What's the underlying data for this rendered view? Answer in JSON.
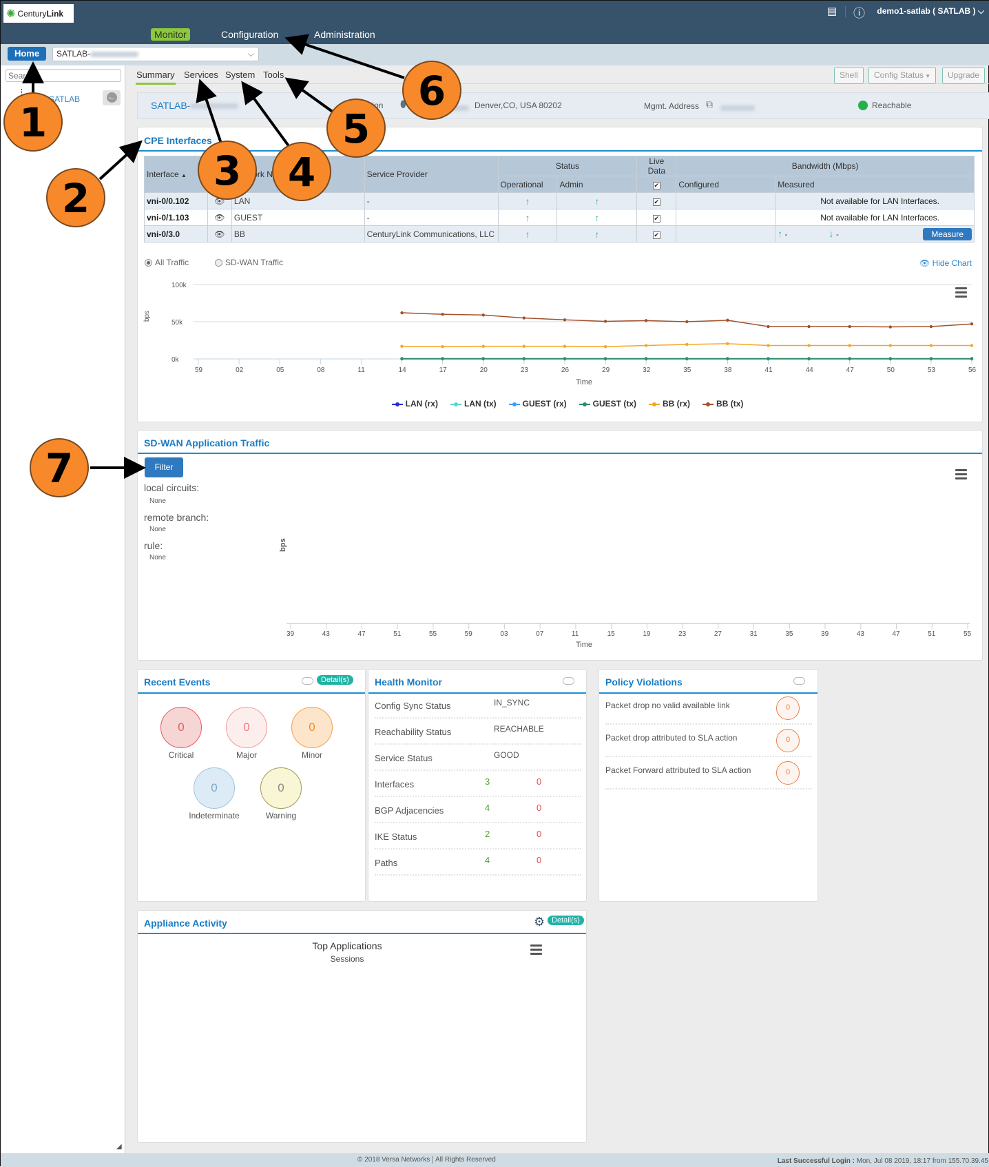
{
  "header": {
    "logo_text_light": "Century",
    "logo_text_bold": "Link",
    "nav": [
      {
        "label": "Monitor",
        "active": true
      },
      {
        "label": "Configuration"
      },
      {
        "label": "Administration"
      }
    ],
    "user": "demo1-satlab ( SATLAB )"
  },
  "subbar": {
    "home": "Home",
    "appliance_select": "SATLAB-"
  },
  "sidebar": {
    "search_placeholder": "Search",
    "tree_item": "SATLAB"
  },
  "tabs": [
    "Summary",
    "Services",
    "System",
    "Tools"
  ],
  "actions": {
    "shell": "Shell",
    "config_status": "Config Status",
    "upgrade": "Upgrade"
  },
  "info": {
    "name": "SATLAB-",
    "location_label": "Location",
    "address": "Denver,CO, USA 80202",
    "mgmt_label": "Mgmt. Address",
    "status": "Reachable",
    "status_color": "#22b24c"
  },
  "cpe": {
    "title": "CPE Interfaces",
    "headers": {
      "interface": "Interface",
      "network": "Network Name",
      "provider": "Service Provider",
      "status": "Status",
      "operational": "Operational",
      "admin": "Admin",
      "live": "Live Data",
      "bandwidth": "Bandwidth (Mbps)",
      "configured": "Configured",
      "measured": "Measured"
    },
    "rows": [
      {
        "interface": "vni-0/0.102",
        "network": "LAN",
        "provider": "-",
        "operational": "up",
        "admin": "up",
        "live": true,
        "measured": "Not available for LAN Interfaces."
      },
      {
        "interface": "vni-0/1.103",
        "network": "GUEST",
        "provider": "-",
        "operational": "up",
        "admin": "up",
        "live": true,
        "measured": "Not available for LAN Interfaces."
      },
      {
        "interface": "vni-0/3.0",
        "network": "BB",
        "provider": "CenturyLink Communications, LLC",
        "operational": "up",
        "admin": "up",
        "live": true,
        "measured_up": "-",
        "measured_down": "-",
        "measure_button": "Measure"
      }
    ],
    "radio_all": "All Traffic",
    "radio_sdwan": "SD-WAN Traffic",
    "selected_radio": "All Traffic",
    "hide_chart": "Hide Chart"
  },
  "chart_data": [
    {
      "type": "line",
      "xlabel": "Time",
      "ylabel": "bps",
      "yticks": [
        "0k",
        "50k",
        "100k"
      ],
      "ylim": [
        0,
        100000
      ],
      "categories": [
        "59",
        "02",
        "05",
        "08",
        "11",
        "14",
        "17",
        "20",
        "23",
        "26",
        "29",
        "32",
        "35",
        "38",
        "41",
        "44",
        "47",
        "50",
        "53",
        "56"
      ],
      "legend_placement": "bottom",
      "grid": true,
      "series": [
        {
          "name": "LAN (rx)",
          "color": "#2230d6",
          "values": [
            null,
            null,
            null,
            null,
            null,
            0,
            0,
            0,
            0,
            0,
            0,
            0,
            0,
            0,
            0,
            0,
            0,
            0,
            0,
            0
          ]
        },
        {
          "name": "LAN (tx)",
          "color": "#55d8c8",
          "values": [
            null,
            null,
            null,
            null,
            null,
            0,
            0,
            0,
            0,
            0,
            0,
            0,
            0,
            0,
            0,
            0,
            0,
            0,
            0,
            0
          ]
        },
        {
          "name": "GUEST (rx)",
          "color": "#3f9ef5",
          "values": [
            null,
            null,
            null,
            null,
            null,
            0,
            0,
            0,
            0,
            0,
            0,
            0,
            0,
            0,
            0,
            0,
            0,
            0,
            0,
            0
          ]
        },
        {
          "name": "GUEST (tx)",
          "color": "#2e8b6b",
          "values": [
            null,
            null,
            null,
            null,
            null,
            500,
            500,
            500,
            500,
            500,
            500,
            500,
            500,
            500,
            500,
            500,
            500,
            500,
            500,
            500
          ]
        },
        {
          "name": "BB (rx)",
          "color": "#f5a623",
          "values": [
            null,
            null,
            null,
            null,
            null,
            17000,
            16500,
            17000,
            17000,
            17000,
            16500,
            18000,
            19500,
            20500,
            18000,
            18000,
            18000,
            18000,
            18000,
            18000
          ]
        },
        {
          "name": "BB (tx)",
          "color": "#a0522d",
          "values": [
            null,
            null,
            null,
            null,
            null,
            62000,
            60000,
            59000,
            55000,
            52500,
            50500,
            51500,
            50000,
            52000,
            43500,
            43500,
            43500,
            43000,
            43500,
            47000
          ]
        }
      ]
    },
    {
      "type": "line",
      "xlabel": "Time",
      "ylabel": "bps",
      "categories": [
        "39",
        "43",
        "47",
        "51",
        "55",
        "59",
        "03",
        "07",
        "11",
        "15",
        "19",
        "23",
        "27",
        "31",
        "35",
        "39",
        "43",
        "47",
        "51",
        "55"
      ],
      "series": []
    }
  ],
  "sdwan": {
    "title": "SD-WAN Application Traffic",
    "filter": "Filter",
    "filters": [
      {
        "label": "local circuits:",
        "value": "None"
      },
      {
        "label": "remote branch:",
        "value": "None"
      },
      {
        "label": "rule:",
        "value": "None"
      }
    ]
  },
  "events": {
    "title": "Recent Events",
    "detail": "Detail(s)",
    "items": [
      {
        "label": "Critical",
        "count": "0"
      },
      {
        "label": "Major",
        "count": "0"
      },
      {
        "label": "Minor",
        "count": "0"
      },
      {
        "label": "Indeterminate",
        "count": "0"
      },
      {
        "label": "Warning",
        "count": "0"
      }
    ]
  },
  "health": {
    "title": "Health Monitor",
    "rows": [
      {
        "label": "Config Sync Status",
        "value": "IN_SYNC"
      },
      {
        "label": "Reachability Status",
        "value": "REACHABLE"
      },
      {
        "label": "Service Status",
        "value": "GOOD"
      },
      {
        "label": "Interfaces",
        "good": "3",
        "bad": "0"
      },
      {
        "label": "BGP Adjacencies",
        "good": "4",
        "bad": "0"
      },
      {
        "label": "IKE Status",
        "good": "2",
        "bad": "0"
      },
      {
        "label": "Paths",
        "good": "4",
        "bad": "0"
      }
    ]
  },
  "policy": {
    "title": "Policy Violations",
    "rows": [
      {
        "label": "Packet drop no valid available link",
        "count": "0"
      },
      {
        "label": "Packet drop attributed to SLA action",
        "count": "0"
      },
      {
        "label": "Packet Forward attributed to SLA action",
        "count": "0"
      }
    ]
  },
  "appliance": {
    "title": "Appliance Activity",
    "detail": "Detail(s)",
    "chart_title": "Top Applications",
    "chart_subtitle": "Sessions"
  },
  "footer": {
    "copyright": "© 2018 Versa Networks",
    "rights": "All Rights Reserved",
    "login_label": "Last Successful Login :",
    "login_value": " Mon, Jul 08 2019, 18:17 from 155.70.39.45"
  },
  "callouts": [
    "1",
    "2",
    "3",
    "4",
    "5",
    "6",
    "7"
  ]
}
